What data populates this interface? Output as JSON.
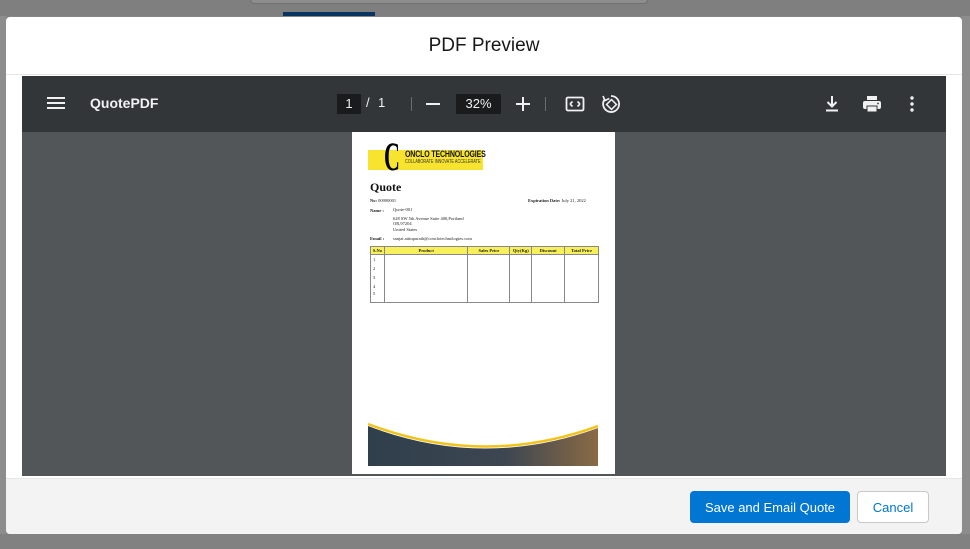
{
  "modal": {
    "title": "PDF Preview"
  },
  "viewer": {
    "doc_title": "QuotePDF",
    "current_page": "1",
    "page_separator": "/",
    "total_pages": "1",
    "zoom": "32%",
    "icons": [
      "menu-icon",
      "zoom-out-icon",
      "zoom-in-icon",
      "fit-page-icon",
      "rotate-icon",
      "download-icon",
      "print-icon",
      "more-options-icon"
    ]
  },
  "document": {
    "logo_letter": "C",
    "company_name": "ONCLO TECHNOLOGIES",
    "tagline": "COLLABORATE INNOVATE ACCELERATE",
    "heading": "Quote",
    "no_label": "No:",
    "no_value": "00000001",
    "expiration_label": "Expiration Date:",
    "expiration_value": "July 21, 2022",
    "name_label": "Name :",
    "name_value": "Quote-001",
    "address_line1": "628 SW 5th Avenue Suite 400,Portland",
    "address_line2": "OR,97204",
    "address_line3": "United States",
    "email_label": "Email :",
    "email_value": "sanjai.atttupurath@conclotechnologies.com",
    "table": {
      "headers": [
        "S.No",
        "Product",
        "Sales Price",
        "Qty(Kg)",
        "Discount",
        "Total Price"
      ],
      "rows": [
        "1",
        "2",
        "3",
        "4",
        "5"
      ]
    },
    "accent_color": "#f8e42f"
  },
  "footer": {
    "save_label": "Save and Email Quote",
    "cancel_label": "Cancel"
  },
  "colors": {
    "primary": "#0176d3",
    "viewer_toolbar": "#323639",
    "viewer_background": "#525659"
  }
}
